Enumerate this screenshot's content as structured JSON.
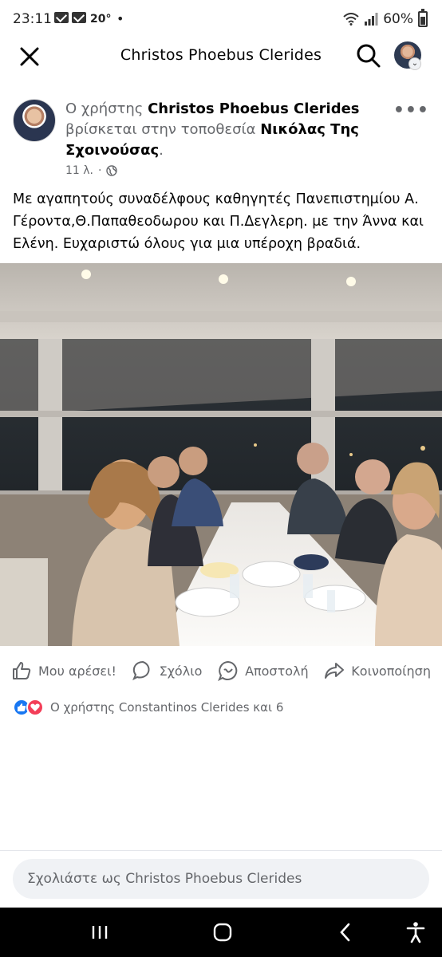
{
  "status_bar": {
    "time": "23:11",
    "temperature": "20°",
    "dot": "•",
    "battery": "60%"
  },
  "top_bar": {
    "title": "Christos Phoebus Clerides"
  },
  "post": {
    "header_prefix": "Ο χρήστης ",
    "author": "Christos Phoebus Clerides",
    "location_connector": " βρίσκεται στην τοποθεσία ",
    "location": "Νικόλας Της Σχοινούσας",
    "header_suffix": ".",
    "time_ago": "11 λ.",
    "meta_separator": "·",
    "more": "•••",
    "text_line1": "Με αγαπητούς συναδέλφους καθηγητές Πανεπιστημίου Α. Γέροντα,Θ.Παπαθεοδωρου  και Π.Δεγλερη. με την Άννα και Ελένη. Ευχαριστώ όλους για μια υπέροχη βραδιά."
  },
  "actions": {
    "like": "Μου αρέσει!",
    "comment": "Σχόλιο",
    "send": "Αποστολή",
    "share": "Κοινοποίηση"
  },
  "reactions": {
    "text": "Ο χρήστης Constantinos Clerides και 6"
  },
  "comment_box": {
    "placeholder": "Σχολιάστε ως Christos Phoebus Clerides"
  },
  "colors": {
    "facebook_blue": "#1877f2",
    "love_red": "#f33e58",
    "secondary_text": "#65676b"
  }
}
